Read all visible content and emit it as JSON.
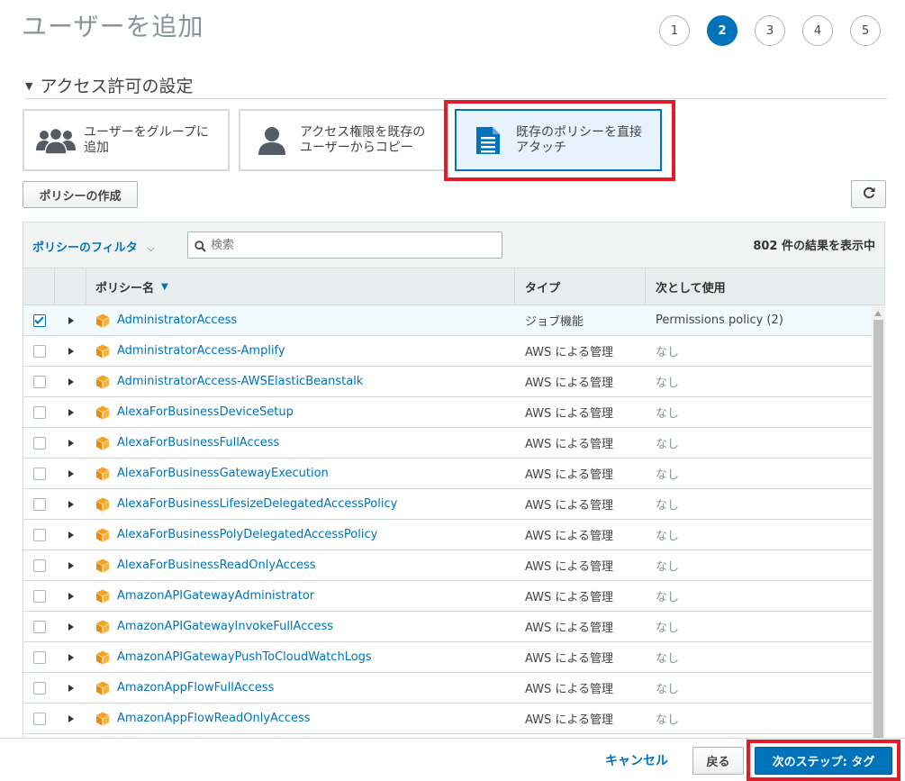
{
  "page": {
    "title": "ユーザーを追加"
  },
  "steps": [
    "1",
    "2",
    "3",
    "4",
    "5"
  ],
  "active_step": "2",
  "section": {
    "title": "アクセス許可の設定"
  },
  "options": [
    {
      "label": "ユーザーをグループに追加",
      "icon": "group-icon",
      "selected": false
    },
    {
      "label": "アクセス権限を既存のユーザーからコピー",
      "icon": "user-icon",
      "selected": false
    },
    {
      "label": "既存のポリシーを直接アタッチ",
      "icon": "document-icon",
      "selected": true
    }
  ],
  "toolbar": {
    "create_policy_label": "ポリシーの作成",
    "refresh_icon": "refresh-icon"
  },
  "filter": {
    "label": "ポリシーのフィルタ",
    "search_placeholder": "検索",
    "result_count": "802 件の結果を表示中"
  },
  "table": {
    "headers": {
      "name": "ポリシー名",
      "type": "タイプ",
      "usage": "次として使用"
    },
    "rows": [
      {
        "name": "AdministratorAccess",
        "type": "ジョブ機能",
        "usage": "Permissions policy (2)",
        "checked": true
      },
      {
        "name": "AdministratorAccess-Amplify",
        "type": "AWS による管理",
        "usage": "なし",
        "checked": false
      },
      {
        "name": "AdministratorAccess-AWSElasticBeanstalk",
        "type": "AWS による管理",
        "usage": "なし",
        "checked": false
      },
      {
        "name": "AlexaForBusinessDeviceSetup",
        "type": "AWS による管理",
        "usage": "なし",
        "checked": false
      },
      {
        "name": "AlexaForBusinessFullAccess",
        "type": "AWS による管理",
        "usage": "なし",
        "checked": false
      },
      {
        "name": "AlexaForBusinessGatewayExecution",
        "type": "AWS による管理",
        "usage": "なし",
        "checked": false
      },
      {
        "name": "AlexaForBusinessLifesizeDelegatedAccessPolicy",
        "type": "AWS による管理",
        "usage": "なし",
        "checked": false
      },
      {
        "name": "AlexaForBusinessPolyDelegatedAccessPolicy",
        "type": "AWS による管理",
        "usage": "なし",
        "checked": false
      },
      {
        "name": "AlexaForBusinessReadOnlyAccess",
        "type": "AWS による管理",
        "usage": "なし",
        "checked": false
      },
      {
        "name": "AmazonAPIGatewayAdministrator",
        "type": "AWS による管理",
        "usage": "なし",
        "checked": false
      },
      {
        "name": "AmazonAPIGatewayInvokeFullAccess",
        "type": "AWS による管理",
        "usage": "なし",
        "checked": false
      },
      {
        "name": "AmazonAPIGatewayPushToCloudWatchLogs",
        "type": "AWS による管理",
        "usage": "なし",
        "checked": false
      },
      {
        "name": "AmazonAppFlowFullAccess",
        "type": "AWS による管理",
        "usage": "なし",
        "checked": false
      },
      {
        "name": "AmazonAppFlowReadOnlyAccess",
        "type": "AWS による管理",
        "usage": "なし",
        "checked": false
      }
    ]
  },
  "footer": {
    "cancel_label": "キャンセル",
    "back_label": "戻る",
    "next_label": "次のステップ: タグ"
  },
  "colors": {
    "accent": "#0073bb",
    "highlight": "#e21b2a",
    "policy_icon": "#f7a21b"
  }
}
